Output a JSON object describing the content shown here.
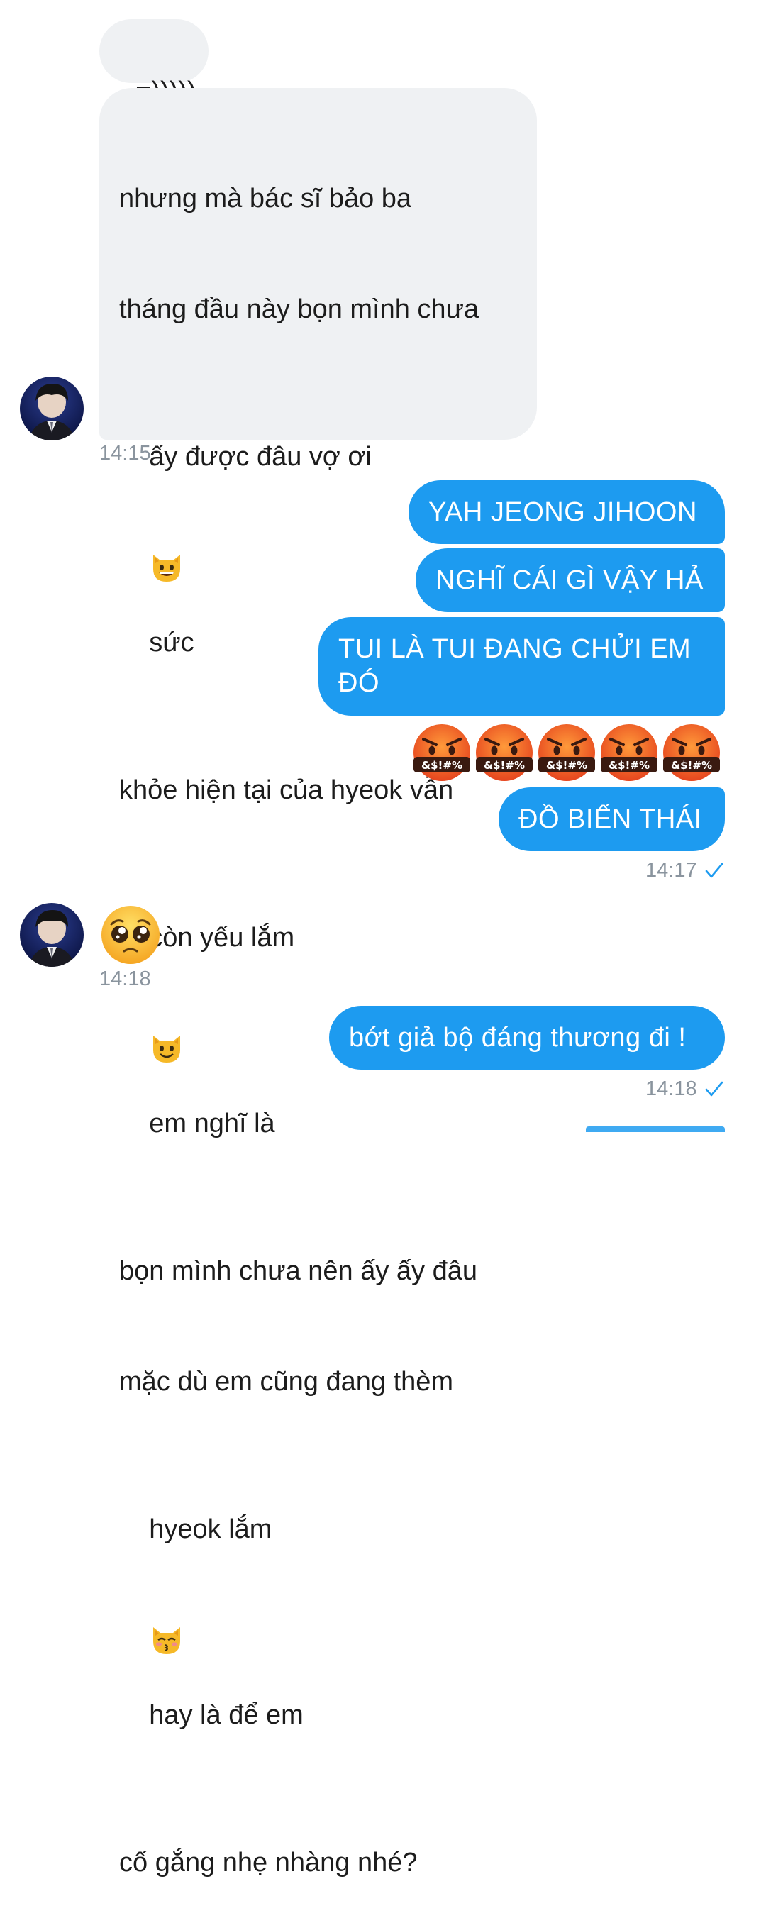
{
  "messages": {
    "incoming_1": {
      "text": "=)))))"
    },
    "incoming_2": {
      "lines": [
        "nhưng mà bác sĩ bảo ba",
        "tháng đầu này bọn mình chưa",
        "ấy được đâu vợ ơi",
        "sức",
        "khỏe hiện tại của hyeok vẫn",
        "còn yếu lắm",
        "em nghĩ là",
        "bọn mình chưa nên ấy ấy đâu",
        "mặc dù em cũng đang thèm",
        "hyeok lắm",
        "hay là để em",
        "cố gắng nhẹ nhàng nhé?"
      ],
      "emojis": [
        "grinning-cat-icon",
        "smiling-cat-icon",
        "kissing-cat-icon"
      ],
      "time": "14:15"
    },
    "outgoing_1": {
      "bubbles": [
        "YAH JEONG JIHOON",
        "NGHĨ CÁI GÌ VẬY HẢ",
        "TUI LÀ TUI ĐANG CHỬI EM",
        "ĐÓ",
        "ĐỒ BIẾN THÁI"
      ],
      "cursing_emojis": {
        "count": 5,
        "symbol_text": "&$!#%",
        "icon": "face-with-symbols-on-mouth-icon"
      },
      "time": "14:17"
    },
    "incoming_3": {
      "emoji": "pleading-face-icon",
      "time": "14:18"
    },
    "outgoing_2": {
      "text": "bớt giả bộ đáng thương đi !",
      "time": "14:18"
    }
  },
  "colors": {
    "incoming_bubble": "#eff1f3",
    "outgoing_bubble": "#1d9bf0",
    "timestamp": "#8a949e",
    "read_check": "#1d9bf0"
  }
}
